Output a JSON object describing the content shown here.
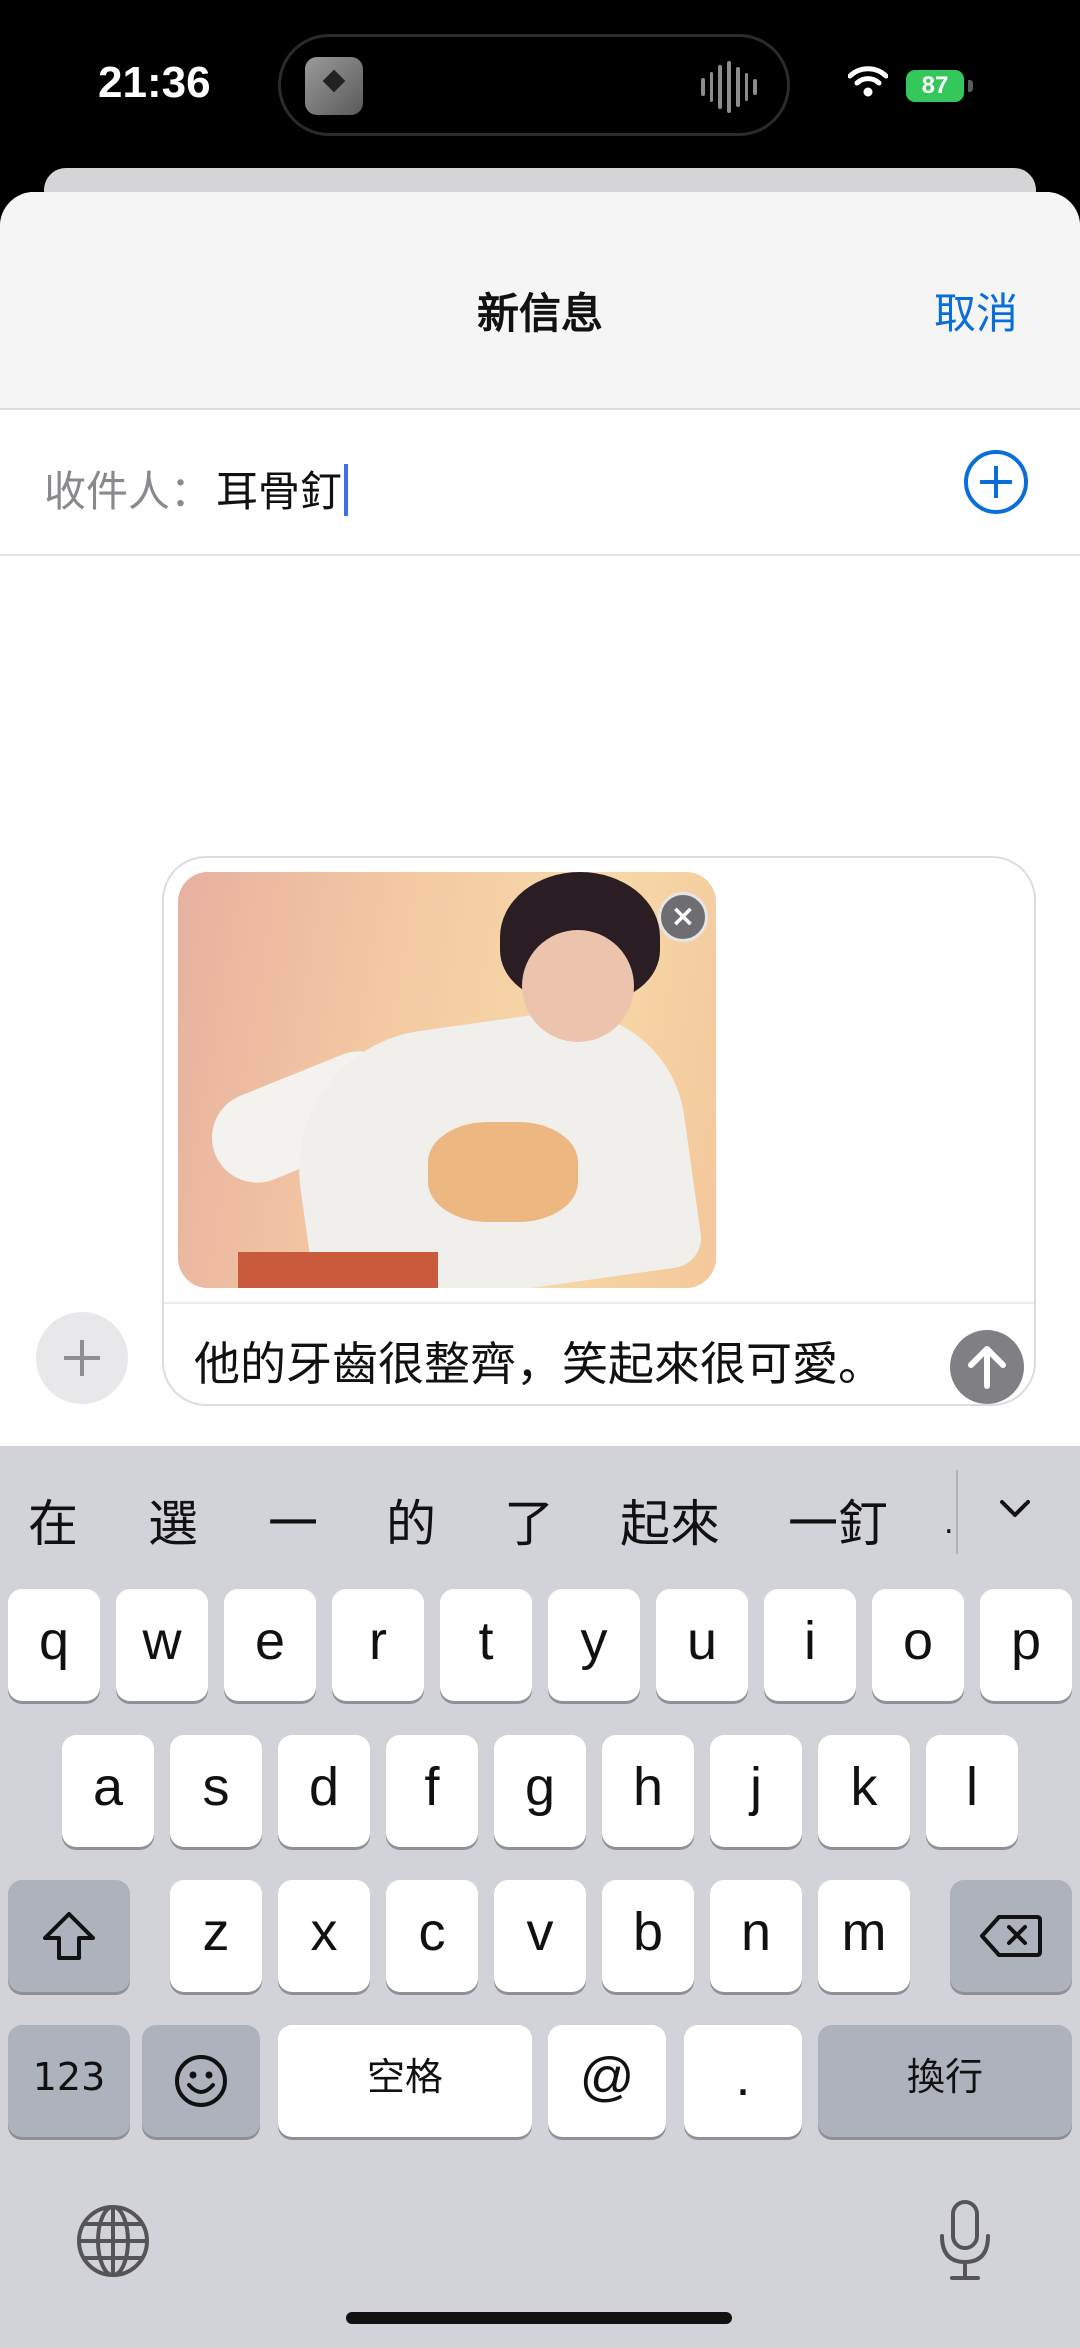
{
  "status_bar": {
    "time": "21:36",
    "battery": "87"
  },
  "header": {
    "title": "新信息",
    "cancel_label": "取消"
  },
  "recipient": {
    "label": "收件人：",
    "value": "耳骨釘"
  },
  "compose": {
    "message_text": "他的牙齒很整齊，笑起來很可愛。"
  },
  "keyboard": {
    "candidates": [
      "在",
      "選",
      "一",
      "的",
      "了",
      "起來",
      "一釘",
      "."
    ],
    "row1": [
      "q",
      "w",
      "e",
      "r",
      "t",
      "y",
      "u",
      "i",
      "o",
      "p"
    ],
    "row2": [
      "a",
      "s",
      "d",
      "f",
      "g",
      "h",
      "j",
      "k",
      "l"
    ],
    "row3": [
      "z",
      "x",
      "c",
      "v",
      "b",
      "n",
      "m"
    ],
    "numbers_label": "123",
    "space_label": "空格",
    "at_label": "@",
    "period_label": ".",
    "return_label": "換行",
    "icons": [
      "shift-icon",
      "delete-icon",
      "emoji-icon",
      "globe-icon",
      "microphone-icon",
      "chevron-down-icon"
    ]
  }
}
